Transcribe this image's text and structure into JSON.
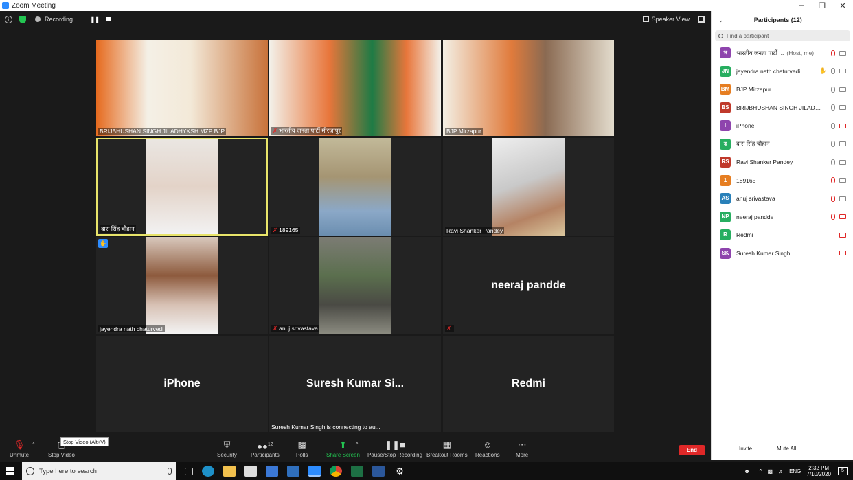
{
  "window": {
    "title": "Zoom Meeting"
  },
  "topbar": {
    "recording_label": "Recording...",
    "speaker_view_label": "Speaker View"
  },
  "tiles": [
    {
      "name": "BRIJBHUSHAN SINGH JILADHYKSH MZP BJP",
      "muted": false,
      "video": true
    },
    {
      "name": "भारतीय जनता पार्टी मीरजापुर",
      "muted": true,
      "video": true
    },
    {
      "name": "BJP Mirzapur",
      "muted": false,
      "video": true
    },
    {
      "name": "दारा सिंह चौहान",
      "muted": false,
      "video": true,
      "active": true
    },
    {
      "name": "189165",
      "muted": true,
      "video": true
    },
    {
      "name": "Ravi Shanker Pandey",
      "muted": false,
      "video": true
    },
    {
      "name": "jayendra nath chaturvedi",
      "muted": false,
      "video": true,
      "hand_raised": true
    },
    {
      "name": "anuj srivastava",
      "muted": true,
      "video": true
    },
    {
      "name": "",
      "big_name": "neeraj pandde",
      "muted": true,
      "video": false
    },
    {
      "name": "",
      "big_name": "iPhone",
      "muted": false,
      "video": false
    },
    {
      "name": "Suresh Kumar Singh is connecting to au...",
      "big_name": "Suresh Kumar Si...",
      "muted": false,
      "video": false
    },
    {
      "name": "",
      "big_name": "Redmi",
      "muted": false,
      "video": false
    }
  ],
  "toolbar": {
    "unmute_label": "Unmute",
    "stop_video_label": "Stop Video",
    "stop_video_tooltip": "Stop Video (Alt+V)",
    "security_label": "Security",
    "participants_label": "Participants",
    "participants_count": "12",
    "polls_label": "Polls",
    "share_screen_label": "Share Screen",
    "recording_label": "Pause/Stop Recording",
    "breakout_label": "Breakout Rooms",
    "reactions_label": "Reactions",
    "more_label": "More",
    "end_label": "End"
  },
  "panel": {
    "title": "Participants (12)",
    "search_placeholder": "Find a participant",
    "host_tag": "(Host, me)",
    "participants": [
      {
        "initials": "भ",
        "name": "भारतीय जनता पार्टी ...",
        "color": "#8e44ad",
        "host": true,
        "mic": "muted",
        "cam": "on"
      },
      {
        "initials": "JN",
        "name": "jayendra nath chaturvedi",
        "color": "#27ae60",
        "hand": true,
        "mic": "on",
        "cam": "on"
      },
      {
        "initials": "BM",
        "name": "BJP Mirzapur",
        "color": "#e67e22",
        "mic": "on",
        "cam": "on"
      },
      {
        "initials": "BS",
        "name": "BRIJBHUSHAN SINGH JILADHYKS...",
        "color": "#c0392b",
        "mic": "on",
        "cam": "on"
      },
      {
        "initials": "I",
        "name": "iPhone",
        "color": "#8e44ad",
        "mic": "on",
        "cam": "off"
      },
      {
        "initials": "द",
        "name": "दारा सिंह चौहान",
        "color": "#27ae60",
        "mic": "on",
        "cam": "on"
      },
      {
        "initials": "RS",
        "name": "Ravi Shanker Pandey",
        "color": "#c0392b",
        "mic": "on",
        "cam": "on"
      },
      {
        "initials": "1",
        "name": "189165",
        "color": "#e67e22",
        "mic": "muted",
        "cam": "on"
      },
      {
        "initials": "AS",
        "name": "anuj srivastava",
        "color": "#2980b9",
        "mic": "muted",
        "cam": "on"
      },
      {
        "initials": "NP",
        "name": "neeraj pandde",
        "color": "#27ae60",
        "mic": "muted",
        "cam": "off"
      },
      {
        "initials": "R",
        "name": "Redmi",
        "color": "#27ae60",
        "mic": "none",
        "cam": "off"
      },
      {
        "initials": "SK",
        "name": "Suresh Kumar Singh",
        "color": "#8e44ad",
        "mic": "none",
        "cam": "off"
      }
    ],
    "invite_label": "Invite",
    "mute_all_label": "Mute All",
    "more_label": "..."
  },
  "taskbar": {
    "search_placeholder": "Type here to search",
    "language": "ENG",
    "time": "2:32 PM",
    "date": "7/10/2020",
    "notifications": "5"
  }
}
